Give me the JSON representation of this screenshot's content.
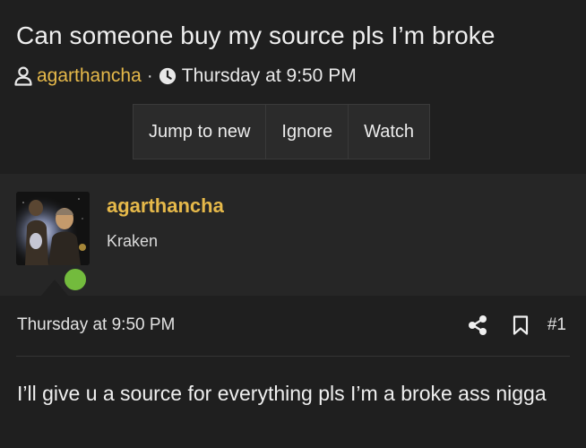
{
  "thread": {
    "title": "Can someone buy my source pls I’m broke",
    "author": "agarthancha",
    "separator": "·",
    "date": "Thursday at 9:50 PM"
  },
  "buttons": {
    "jump": "Jump to new",
    "ignore": "Ignore",
    "watch": "Watch"
  },
  "post": {
    "username": "agarthancha",
    "user_title": "Kraken",
    "date": "Thursday at 9:50 PM",
    "number": "#1",
    "message": "I’ll give u a source for everything pls I’m a broke ass nigga"
  },
  "icons": {
    "meta_user": "user-icon",
    "meta_clock": "clock-icon",
    "share": "share-icon",
    "bookmark": "bookmark-icon"
  },
  "colors": {
    "background": "#1f1f1f",
    "user_panel": "#262626",
    "accent_link": "#e6b94a",
    "online": "#73bb3d",
    "button_bg": "#2b2b2b"
  }
}
